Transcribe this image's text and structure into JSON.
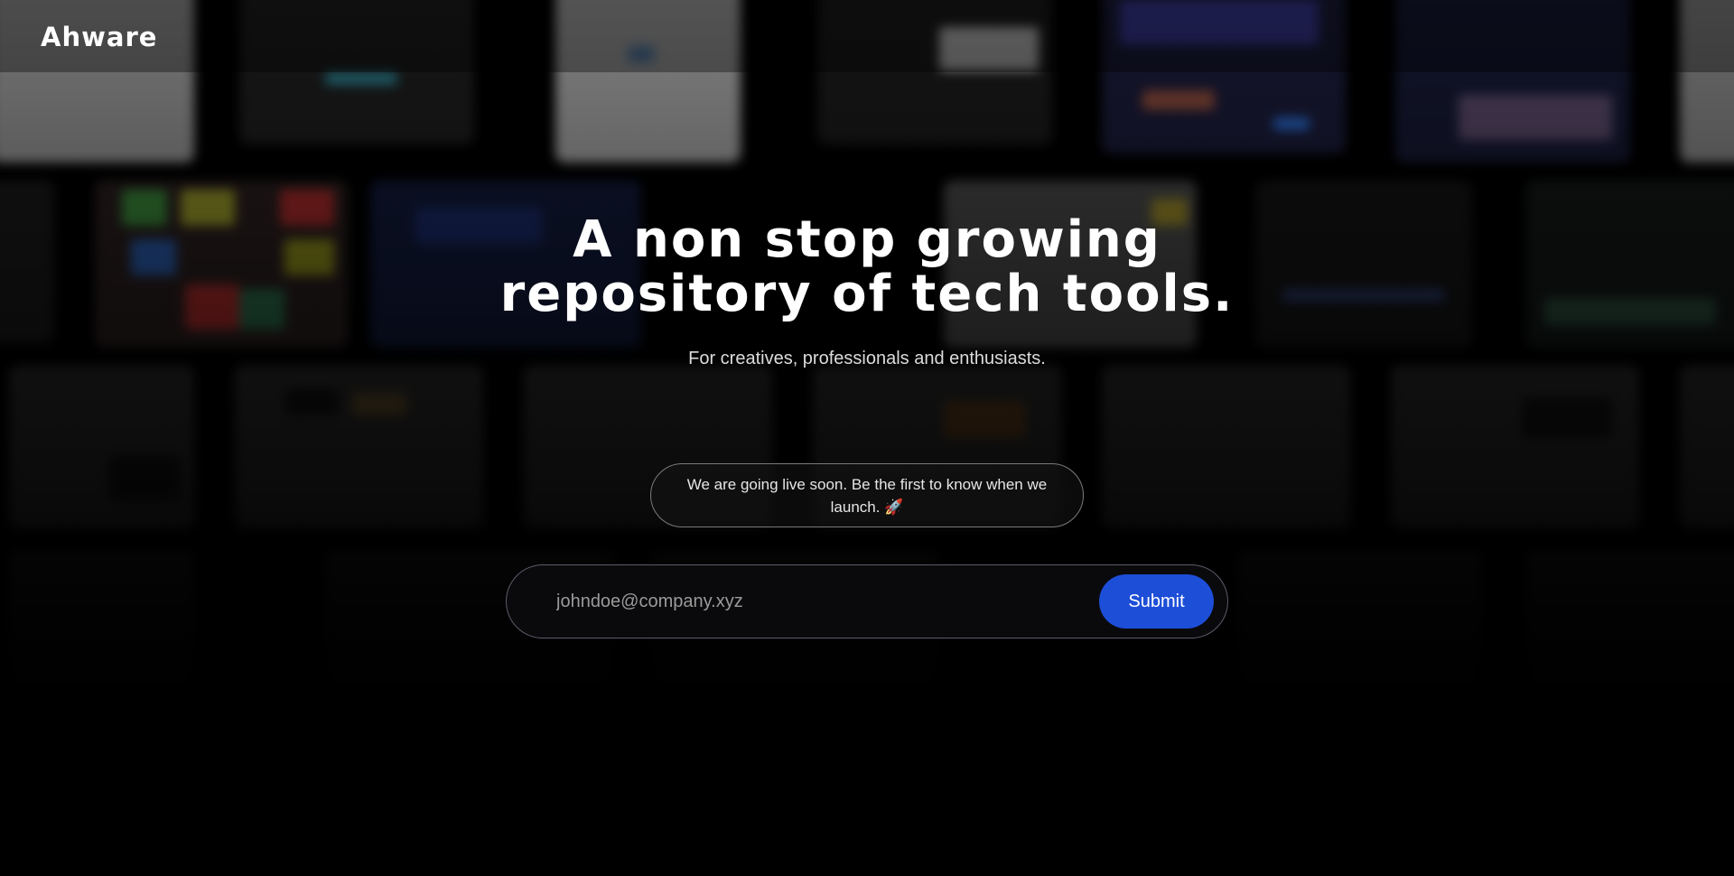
{
  "header": {
    "logo": "Ahware"
  },
  "hero": {
    "headline_line1": "A non stop growing",
    "headline_line2": "repository of tech tools.",
    "subtitle": "For creatives, professionals and enthusiasts."
  },
  "notice": {
    "text": "We are going live soon. Be the first to know when we launch. 🚀"
  },
  "signup": {
    "placeholder": "johndoe@company.xyz",
    "value": "",
    "submit_label": "Submit"
  },
  "colors": {
    "accent": "#1d4ed8",
    "background": "#000000"
  }
}
